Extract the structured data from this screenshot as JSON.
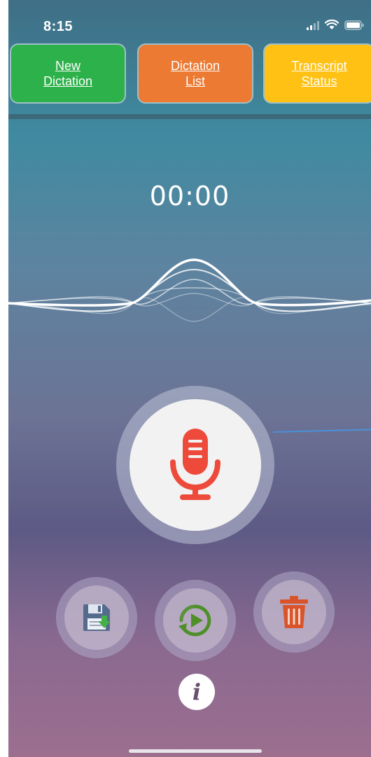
{
  "status_bar": {
    "time": "8:15",
    "icons": [
      "signal-icon",
      "wifi-icon",
      "battery-icon"
    ]
  },
  "tabs": [
    {
      "label": "New\nDictation",
      "color": "#2db14a"
    },
    {
      "label": "Dictation\nList",
      "color": "#ec7a32"
    },
    {
      "label": "Transcript\nStatus",
      "color": "#ffc113"
    }
  ],
  "recorder": {
    "timer": "00:00",
    "mic_icon": "microphone-icon",
    "mic_color": "#ee4a3b"
  },
  "actions": [
    {
      "name": "save",
      "icon": "save-icon"
    },
    {
      "name": "play",
      "icon": "replay-play-icon"
    },
    {
      "name": "delete",
      "icon": "trash-icon"
    }
  ],
  "info": {
    "glyph": "i",
    "icon": "info-icon"
  }
}
